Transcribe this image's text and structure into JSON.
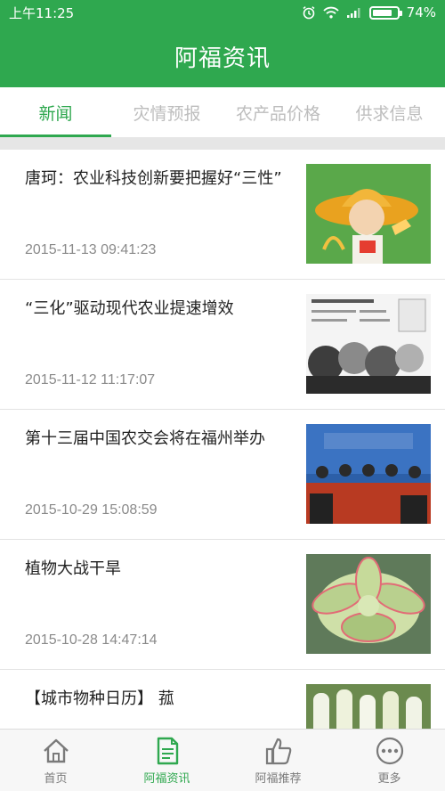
{
  "statusbar": {
    "time": "上午11:25",
    "battery": "74%"
  },
  "appbar": {
    "title": "阿福资讯"
  },
  "tabs": [
    {
      "label": "新闻",
      "active": true
    },
    {
      "label": "灾情预报",
      "active": false
    },
    {
      "label": "农产品价格",
      "active": false
    },
    {
      "label": "供求信息",
      "active": false
    }
  ],
  "news": [
    {
      "title": "唐珂：农业科技创新要把握好“三性”",
      "date": "2015-11-13 09:41:23",
      "thumb": "farmer-cartoon-image"
    },
    {
      "title": "“三化”驱动现代农业提速增效",
      "date": "2015-11-12 11:17:07",
      "thumb": "grain-infographic-image"
    },
    {
      "title": "第十三届中国农交会将在福州举办",
      "date": "2015-10-29 15:08:59",
      "thumb": "press-conference-image"
    },
    {
      "title": "植物大战干旱",
      "date": "2015-10-28 14:47:14",
      "thumb": "succulent-plant-image"
    },
    {
      "title": "【城市物种日历】 菰",
      "date": "",
      "thumb": "wild-rice-stems-image"
    }
  ],
  "bottomnav": [
    {
      "label": "首页",
      "icon": "home-icon",
      "active": false
    },
    {
      "label": "阿福资讯",
      "icon": "news-document-icon",
      "active": true
    },
    {
      "label": "阿福推荐",
      "icon": "thumbs-up-icon",
      "active": false
    },
    {
      "label": "更多",
      "icon": "more-dots-icon",
      "active": false
    }
  ],
  "colors": {
    "primary": "#2fa84f",
    "inactive_tab": "#bdbdbd",
    "date": "#8a8a8a"
  }
}
